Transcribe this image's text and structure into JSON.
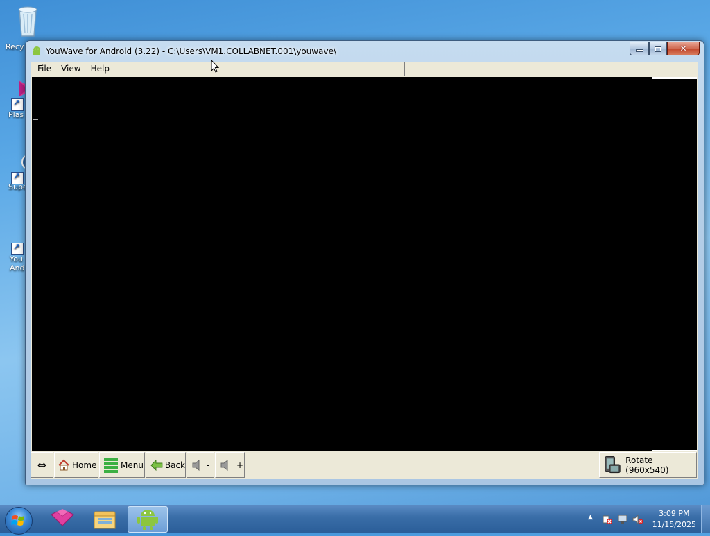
{
  "desktop": {
    "icons": [
      {
        "label": "Recy"
      },
      {
        "label": "Plas"
      },
      {
        "label": "Supe"
      },
      {
        "label": "You\nAnd"
      }
    ]
  },
  "window": {
    "title": "YouWave for Android (3.22) - C:\\Users\\VM1.COLLABNET.001\\youwave\\",
    "menus": [
      "File",
      "View",
      "Help"
    ]
  },
  "toolbar": {
    "home_label": "Home",
    "menu_label": "Menu",
    "back_label": "Back",
    "vol_down_label": "-",
    "vol_up_label": "+",
    "rotate_label": "Rotate (960x540)"
  },
  "taskbar": {
    "time": "3:09 PM",
    "date": "11/15/2025"
  }
}
